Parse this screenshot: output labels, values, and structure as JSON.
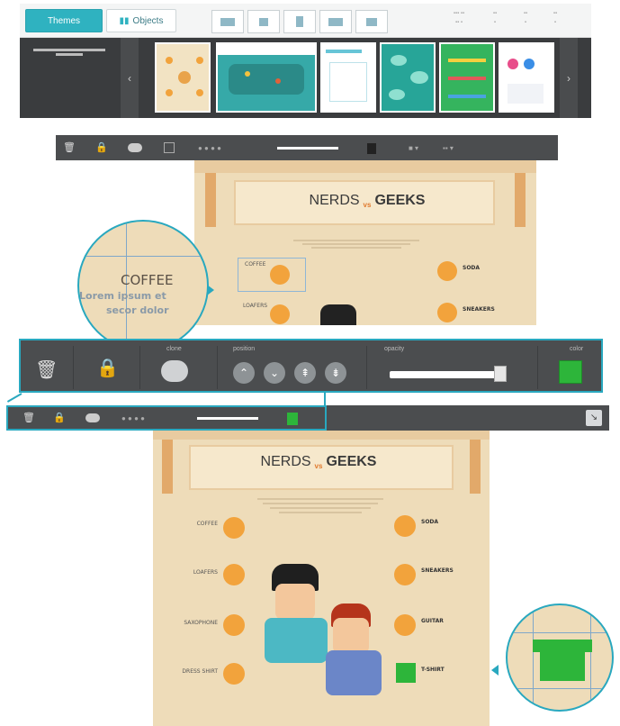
{
  "topbar": {
    "themes_label": "Themes",
    "objects_label": "Objects",
    "layouts": [
      "",
      "",
      "",
      "",
      ""
    ],
    "right_info": [
      "",
      "",
      "",
      ""
    ]
  },
  "strip": {
    "hint": ""
  },
  "poster": {
    "title_left": "NERDS",
    "title_vs": "vs",
    "title_right": "GEEKS",
    "left_items": [
      "COFFEE",
      "LOAFERS",
      "SAXOPHONE",
      "DRESS SHIRT"
    ],
    "right_items": [
      "SODA",
      "SNEAKERS",
      "GUITAR",
      "T-SHIRT"
    ]
  },
  "zoom": {
    "label": "COFFEE",
    "line1": "Lorem ipsum et",
    "line2": "secor dolor"
  },
  "toolbar_big": {
    "clone": "clone",
    "position": "position",
    "opacity": "opacity",
    "color": "color"
  },
  "colors": {
    "accent": "#2fb2c0",
    "toolbar": "#4b4d4f",
    "poster": "#eedcb9",
    "orange": "#f2a33c",
    "green": "#2db53a"
  }
}
